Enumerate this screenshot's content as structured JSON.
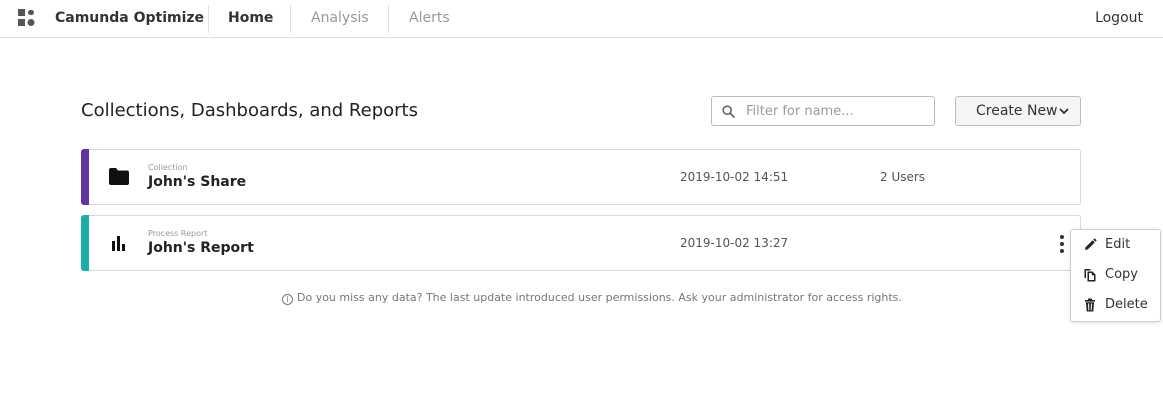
{
  "header": {
    "brand": "Camunda Optimize",
    "nav": [
      {
        "label": "Home",
        "active": true
      },
      {
        "label": "Analysis",
        "active": false
      },
      {
        "label": "Alerts",
        "active": false
      }
    ],
    "logout_label": "Logout",
    "logo_icon": "camunda-logo-icon"
  },
  "main": {
    "title": "Collections, Dashboards, and Reports",
    "search": {
      "placeholder": "Filter for name...",
      "value": ""
    },
    "create_button": {
      "label": "Create New",
      "icon": "chevron-down-icon"
    },
    "rows": [
      {
        "kind": "Collection",
        "name": "John's Share",
        "date": "2019-10-02 14:51",
        "meta": "2 Users",
        "icon": "folder-icon",
        "color": "#5d35a3"
      },
      {
        "kind": "Process Report",
        "name": "John's Report",
        "date": "2019-10-02 13:27",
        "meta": "",
        "icon": "bar-chart-icon",
        "color": "#1aafa6"
      }
    ],
    "notice": "Do you miss any data? The last update introduced user permissions. Ask your administrator for access rights."
  },
  "context_menu": {
    "items": [
      {
        "label": "Edit",
        "icon": "pencil-icon"
      },
      {
        "label": "Copy",
        "icon": "copy-icon"
      },
      {
        "label": "Delete",
        "icon": "trash-icon"
      }
    ]
  }
}
